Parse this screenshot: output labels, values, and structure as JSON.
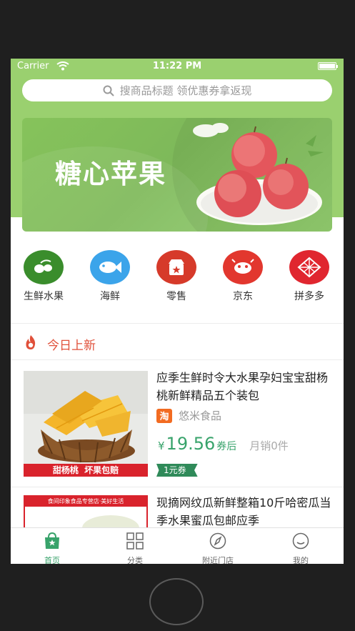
{
  "status": {
    "carrier": "Carrier",
    "time": "11:22 PM"
  },
  "search": {
    "placeholder": "搜商品标题 领优惠券拿返现"
  },
  "banner": {
    "title": "糖心苹果"
  },
  "categories": [
    {
      "label": "生鲜水果",
      "icon": "fruit-icon",
      "color": "#3a8d2c"
    },
    {
      "label": "海鲜",
      "icon": "fish-icon",
      "color": "#3ba4ea"
    },
    {
      "label": "零售",
      "icon": "retail-icon",
      "color": "#d63a2a"
    },
    {
      "label": "京东",
      "icon": "jd-icon",
      "color": "#e2372e"
    },
    {
      "label": "拼多多",
      "icon": "pinduoduo-icon",
      "color": "#e0262f"
    }
  ],
  "section": {
    "title": "今日上新"
  },
  "products": [
    {
      "title": "应季生鲜时令大水果孕妇宝宝甜杨桃新鲜精品五个装包",
      "shop_badge": "淘",
      "shop": "悠米食品",
      "currency": "¥",
      "price": "19.56",
      "price_suffix": "券后",
      "sales": "月销0件",
      "coupon": "1元券",
      "image_caption": "甜杨桃  坏果包赔"
    },
    {
      "title": "现摘网纹瓜新鲜整箱10斤哈密瓜当季水果蜜瓜包邮应季",
      "image_caption": "食间印象食品专营店·美好生活"
    }
  ],
  "tabs": [
    {
      "label": "首页",
      "icon": "home-bag-icon",
      "active": true
    },
    {
      "label": "分类",
      "icon": "grid-icon",
      "active": false
    },
    {
      "label": "附近门店",
      "icon": "compass-icon",
      "active": false
    },
    {
      "label": "我的",
      "icon": "smile-icon",
      "active": false
    }
  ],
  "colors": {
    "primary_green": "#9ad06f",
    "price_green": "#38a36b",
    "accent_red": "#e0503a"
  }
}
